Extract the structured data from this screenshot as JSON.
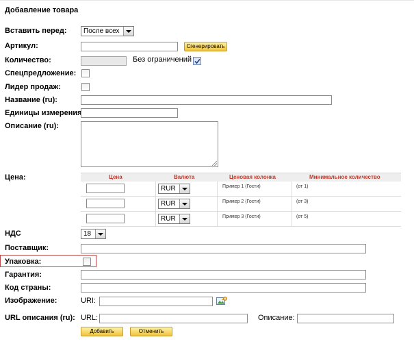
{
  "page": {
    "title": "Добавление товара"
  },
  "form": {
    "insert_before": {
      "label": "Вставить перед:",
      "value": "После всех"
    },
    "article": {
      "label": "Артикул:",
      "value": "",
      "generate_label": "Сгенерировать"
    },
    "quantity": {
      "label": "Количество:",
      "value": "",
      "unlimited_label": "Без ограничений",
      "unlimited_checked": true
    },
    "special_offer": {
      "label": "Спецпредложение:",
      "checked": false
    },
    "bestseller": {
      "label": "Лидер продаж:",
      "checked": false
    },
    "name": {
      "label": "Название (ru):",
      "value": ""
    },
    "units": {
      "label": "Единицы измерения:",
      "value": ""
    },
    "description": {
      "label": "Описание (ru):",
      "value": ""
    },
    "price": {
      "label": "Цена:",
      "headers": [
        "Цена",
        "Валюта",
        "Ценовая колонка",
        "Минимальное количество"
      ],
      "rows": [
        {
          "price": "",
          "currency": "RUR",
          "column": "Пример 1 (Гости)",
          "min_qty": "(от 1)"
        },
        {
          "price": "",
          "currency": "RUR",
          "column": "Пример 2 (Гости)",
          "min_qty": "(от 3)"
        },
        {
          "price": "",
          "currency": "RUR",
          "column": "Пример 3 (Гости)",
          "min_qty": "(от 5)"
        }
      ]
    },
    "vat": {
      "label": "НДС",
      "value": "18"
    },
    "supplier": {
      "label": "Поставщик:",
      "value": ""
    },
    "packaging": {
      "label": "Упаковка:",
      "checked": false
    },
    "warranty": {
      "label": "Гарантия:",
      "value": ""
    },
    "country_code": {
      "label": "Код страны:",
      "value": ""
    },
    "image": {
      "label": "Изображение:",
      "url_label": "URI:",
      "value": ""
    },
    "url_description": {
      "label": "URL описания (ru):",
      "url_label": "URL:",
      "desc_label": "Описание:",
      "url_value": "",
      "desc_value": ""
    }
  },
  "actions": {
    "add_label": "Добавить",
    "cancel_label": "Отменить"
  },
  "colors": {
    "header_text": "#c0392b",
    "button_gradient_top": "#fff2a8",
    "button_gradient_bottom": "#f0c23a",
    "highlight_border": "#b84a4a"
  },
  "icons": {
    "image_picker": "image-add-icon",
    "checkbox_tick": "check-icon",
    "dropdown": "chevron-down-icon"
  }
}
